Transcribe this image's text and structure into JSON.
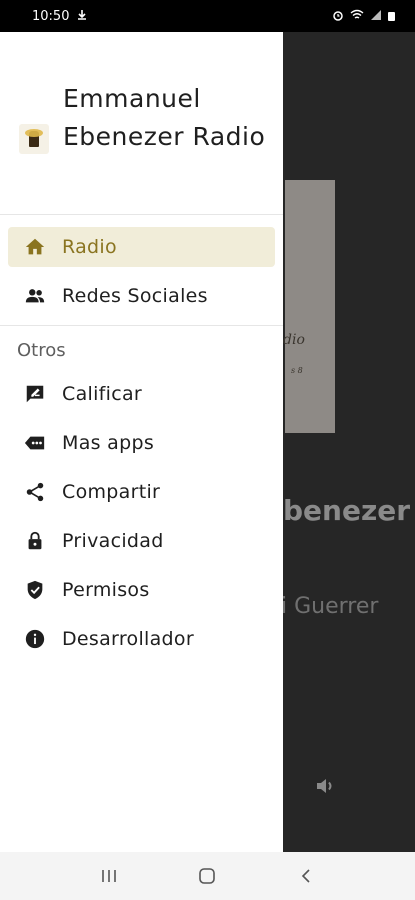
{
  "status": {
    "time": "10:50"
  },
  "drawer": {
    "app_title": "Emmanuel Ebenezer Radio",
    "primary_items": [
      {
        "label": "Radio",
        "icon": "home-icon",
        "active": true
      },
      {
        "label": "Redes Sociales",
        "icon": "people-icon",
        "active": false
      }
    ],
    "section_title": "Otros",
    "other_items": [
      {
        "label": "Calificar",
        "icon": "rate-review-icon"
      },
      {
        "label": "Mas apps",
        "icon": "more-apps-icon"
      },
      {
        "label": "Compartir",
        "icon": "share-icon"
      },
      {
        "label": "Privacidad",
        "icon": "lock-icon"
      },
      {
        "label": "Permisos",
        "icon": "shield-check-icon"
      },
      {
        "label": "Desarrollador",
        "icon": "info-icon"
      }
    ]
  },
  "background_app": {
    "station_name_partial": "benezer",
    "subtitle_partial": "i Guerrer",
    "art_text_partial": "dio",
    "art_sub_partial": "s 8"
  },
  "colors": {
    "accent": "#8a7420",
    "active_bg": "#f1edd9"
  }
}
